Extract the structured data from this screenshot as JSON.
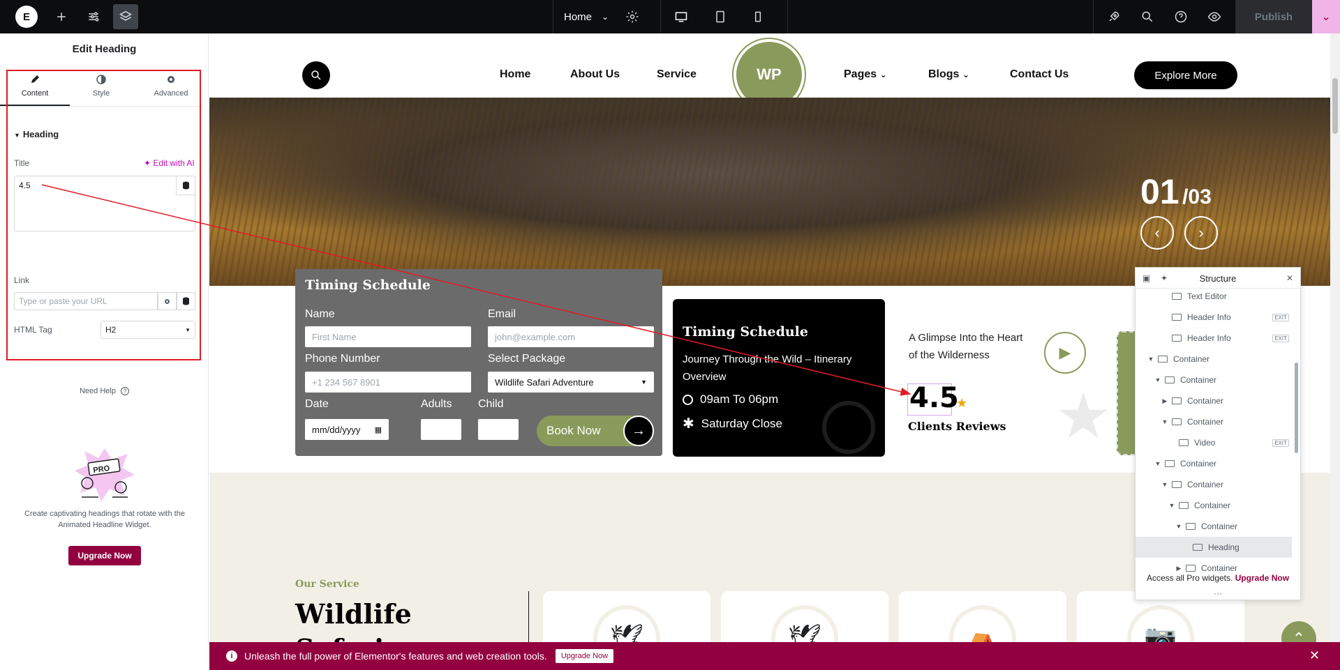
{
  "topbar": {
    "page_name": "Home",
    "publish_label": "Publish"
  },
  "panel": {
    "title": "Edit Heading",
    "tabs": [
      {
        "label": "Content",
        "icon": "pencil-icon"
      },
      {
        "label": "Style",
        "icon": "half-circle-icon"
      },
      {
        "label": "Advanced",
        "icon": "gear-icon"
      }
    ],
    "section": "Heading",
    "title_label": "Title",
    "edit_ai": "Edit with AI",
    "title_value": "4.5",
    "link_label": "Link",
    "link_placeholder": "Type or paste your URL",
    "html_tag_label": "HTML Tag",
    "html_tag_value": "H2",
    "need_help": "Need Help",
    "promo_badge": "PRO",
    "promo_text": "Create captivating headings that rotate with the Animated Headline Widget.",
    "upgrade_label": "Upgrade Now"
  },
  "site": {
    "nav": [
      "Home",
      "About Us",
      "Service",
      "Pages",
      "Blogs",
      "Contact Us"
    ],
    "logo_text": "WP",
    "explore_label": "Explore More",
    "slide_current": "01",
    "slide_total": "/03",
    "booking": {
      "title": "Timing Schedule",
      "name_label": "Name",
      "name_placeholder": "First Name",
      "email_label": "Email",
      "email_placeholder": "john@example.com",
      "phone_label": "Phone Number",
      "phone_placeholder": "+1 234 567 8901",
      "package_label": "Select Package",
      "package_value": "Wildlife Safari Adventure",
      "date_label": "Date",
      "date_placeholder": "mm/dd/yyyy",
      "adults_label": "Adults",
      "child_label": "Child",
      "book_label": "Book Now"
    },
    "timing": {
      "title": "Timing Schedule",
      "subtitle": "Journey Through the Wild – Itinerary Overview",
      "hours": "09am To 06pm",
      "closed": "Saturday Close"
    },
    "glimpse": "A Glimpse Into the Heart of the Wilderness",
    "rating": "4.5",
    "clients_reviews": "Clients Reviews",
    "our_service": "Our Service",
    "services_title": "Wildlife Safari Services"
  },
  "promo_bar": {
    "message": "Unleash the full power of Elementor's features and web creation tools.",
    "button": "Upgrade Now"
  },
  "structure": {
    "title": "Structure",
    "rows": [
      {
        "label": "Text Editor",
        "indent": 4,
        "arrow": "",
        "exit": false
      },
      {
        "label": "Header Info",
        "indent": 4,
        "arrow": "",
        "exit": true
      },
      {
        "label": "Header Info",
        "indent": 4,
        "arrow": "",
        "exit": true
      },
      {
        "label": "Container",
        "indent": 2,
        "arrow": "down",
        "exit": false
      },
      {
        "label": "Container",
        "indent": 3,
        "arrow": "down",
        "exit": false
      },
      {
        "label": "Container",
        "indent": 4,
        "arrow": "right",
        "exit": false
      },
      {
        "label": "Container",
        "indent": 4,
        "arrow": "down",
        "exit": false
      },
      {
        "label": "Video",
        "indent": 5,
        "arrow": "",
        "exit": true
      },
      {
        "label": "Container",
        "indent": 3,
        "arrow": "down",
        "exit": false
      },
      {
        "label": "Container",
        "indent": 4,
        "arrow": "down",
        "exit": false
      },
      {
        "label": "Container",
        "indent": 5,
        "arrow": "down",
        "exit": false
      },
      {
        "label": "Container",
        "indent": 6,
        "arrow": "down",
        "exit": false
      },
      {
        "label": "Heading",
        "indent": 7,
        "arrow": "",
        "exit": false,
        "selected": true
      },
      {
        "label": "Container",
        "indent": 6,
        "arrow": "right",
        "exit": false
      }
    ],
    "exit_label": "EXIT",
    "footer_text": "Access all Pro widgets.",
    "footer_link": "Upgrade Now"
  }
}
